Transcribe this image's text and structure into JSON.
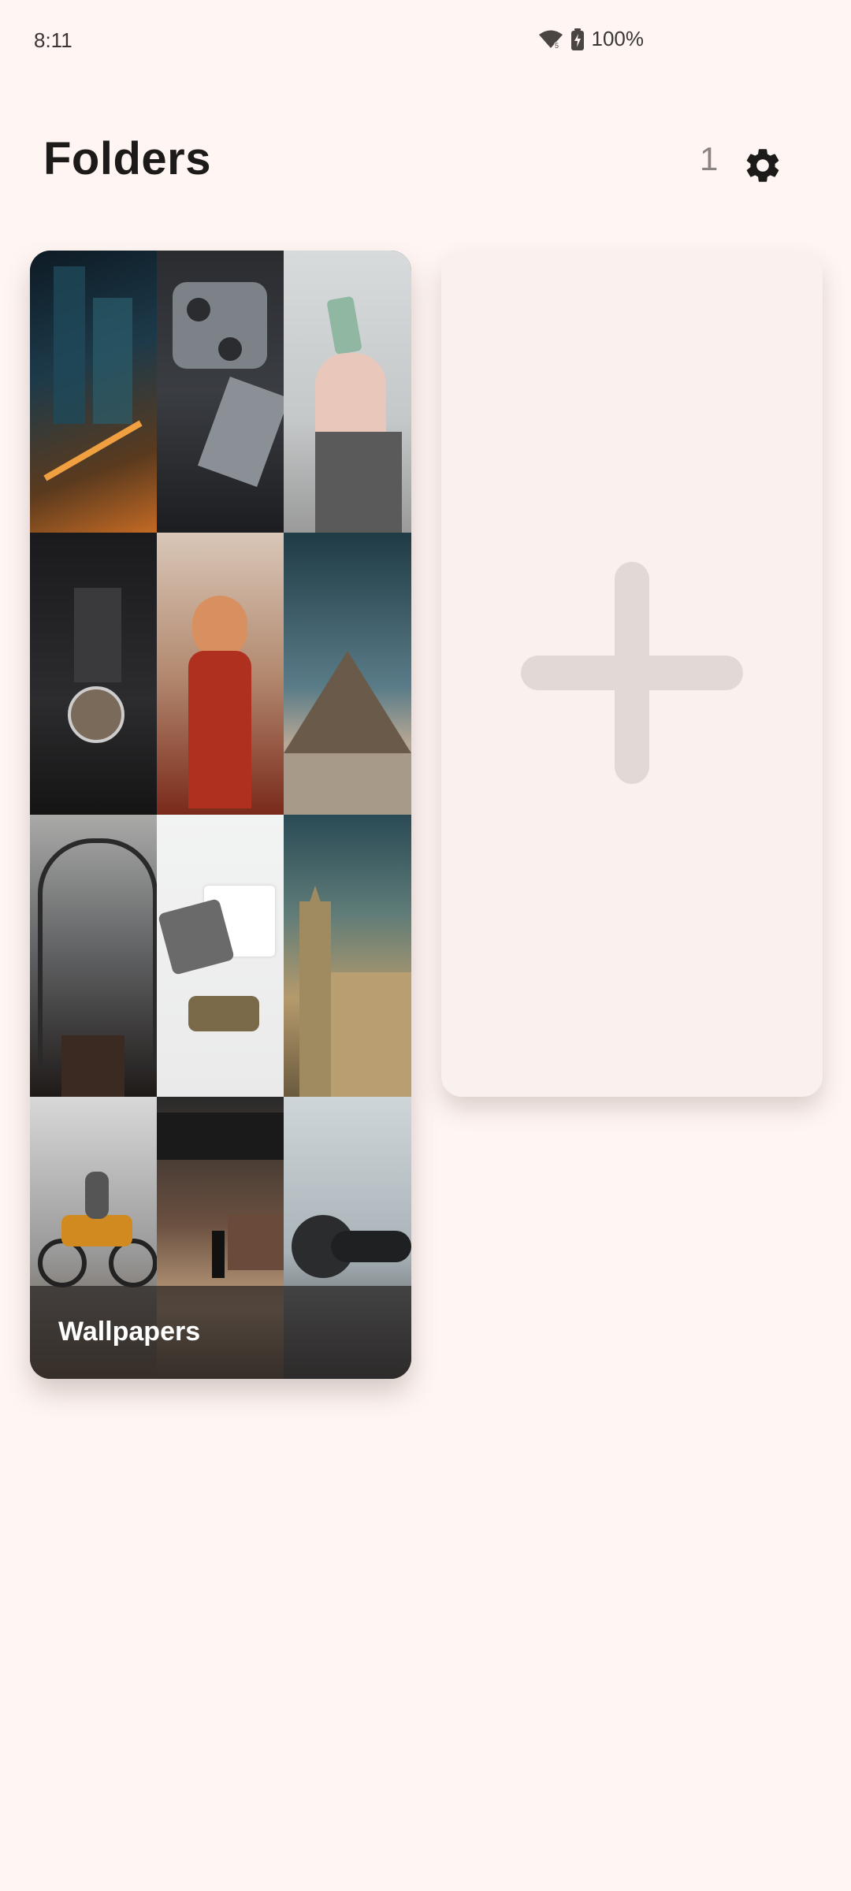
{
  "status_bar": {
    "time": "8:11",
    "battery": "100%",
    "icons": [
      "wifi-icon",
      "battery-charging-icon"
    ]
  },
  "header": {
    "title": "Folders",
    "count": "1",
    "settings_icon": "gear-icon"
  },
  "folders": [
    {
      "name": "Wallpapers",
      "thumbnails": [
        "city-night-aerial",
        "drone-controller",
        "hand-holding-crystal",
        "dark-mirror-interior",
        "anime-girl-red-dress",
        "pyramid-desert",
        "glass-tunnel-escalator",
        "jeans-shirt-boots",
        "gothic-building",
        "motorcycle-rider",
        "train-station",
        "headphones"
      ]
    }
  ],
  "add_folder": {
    "icon": "plus-icon"
  },
  "colors": {
    "background": "#fff6f3",
    "card": "#f9f1ed",
    "plus": "#e2d9d7",
    "text": "#1d1b1a"
  }
}
